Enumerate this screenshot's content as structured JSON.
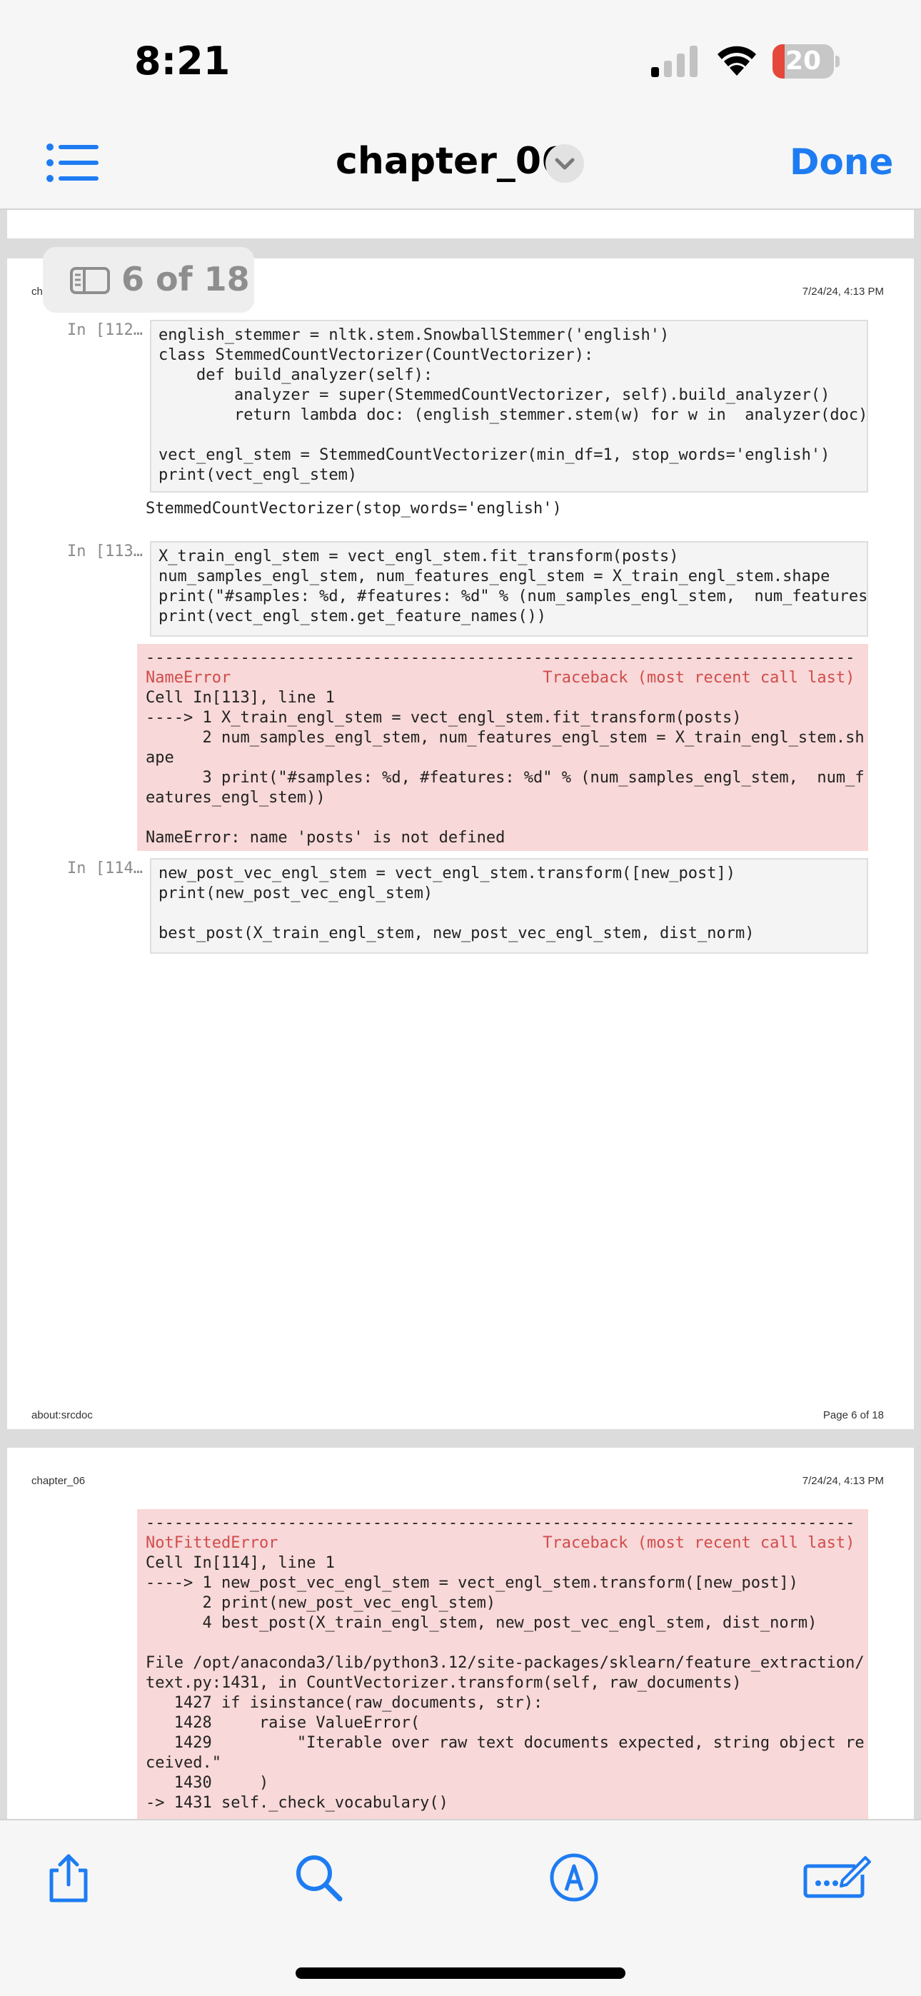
{
  "status_bar": {
    "time": "8:21",
    "battery_percent": 20,
    "battery_color": "#e5483b",
    "signal_bars_active": 1,
    "signal_bars_total": 4,
    "icons": [
      "cellular-signal-icon",
      "wifi-icon",
      "battery-icon"
    ]
  },
  "navbar": {
    "title": "chapter_06",
    "done_label": "Done",
    "accent_color": "#1e7cf2",
    "icons": [
      "list-icon",
      "chevron-down-icon"
    ]
  },
  "page_badge": {
    "text": "6 of 18",
    "icon": "sidebar-icon"
  },
  "current_page": {
    "header_title": "ch",
    "header_date": "7/24/24, 4:13 PM",
    "footer_source": "about:srcdoc",
    "footer_page": "Page 6 of 18",
    "cell1": {
      "prompt": "In [112…",
      "lines": [
        "english_stemmer = nltk.stem.SnowballStemmer('english')",
        "class StemmedCountVectorizer(CountVectorizer):",
        "    def build_analyzer(self):",
        "        analyzer = super(StemmedCountVectorizer, self).build_analyzer()",
        "        return lambda doc: (english_stemmer.stem(w) for w in  analyzer(doc))",
        "",
        "vect_engl_stem = StemmedCountVectorizer(min_df=1, stop_words='english')",
        "print(vect_engl_stem)"
      ],
      "output": "StemmedCountVectorizer(stop_words='english')"
    },
    "cell2": {
      "prompt": "In [113…",
      "lines": [
        "X_train_engl_stem = vect_engl_stem.fit_transform(posts)",
        "num_samples_engl_stem, num_features_engl_stem = X_train_engl_stem.shape",
        "print(\"#samples: %d, #features: %d\" % (num_samples_engl_stem,  num_features_",
        "print(vect_engl_stem.get_feature_names())"
      ],
      "error_lines": [
        "---------------------------------------------------------------------------",
        "NameError                                 Traceback (most recent call last)",
        "Cell In[113], line 1",
        "----> 1 X_train_engl_stem = vect_engl_stem.fit_transform(posts)",
        "      2 num_samples_engl_stem, num_features_engl_stem = X_train_engl_stem.sh",
        "ape",
        "      3 print(\"#samples: %d, #features: %d\" % (num_samples_engl_stem,  num_f",
        "eatures_engl_stem))",
        "",
        "NameError: name 'posts' is not defined"
      ]
    },
    "cell3": {
      "prompt": "In [114…",
      "lines": [
        "new_post_vec_engl_stem = vect_engl_stem.transform([new_post])",
        "print(new_post_vec_engl_stem)",
        "",
        "best_post(X_train_engl_stem, new_post_vec_engl_stem, dist_norm)"
      ]
    }
  },
  "next_page": {
    "header_title": "chapter_06",
    "header_date": "7/24/24, 4:13 PM",
    "error_lines": [
      "---------------------------------------------------------------------------",
      "NotFittedError                            Traceback (most recent call last)",
      "Cell In[114], line 1",
      "----> 1 new_post_vec_engl_stem = vect_engl_stem.transform([new_post])",
      "      2 print(new_post_vec_engl_stem)",
      "      4 best_post(X_train_engl_stem, new_post_vec_engl_stem, dist_norm)",
      "",
      "File /opt/anaconda3/lib/python3.12/site-packages/sklearn/feature_extraction/",
      "text.py:1431, in CountVectorizer.transform(self, raw_documents)",
      "   1427 if isinstance(raw_documents, str):",
      "   1428     raise ValueError(",
      "   1429         \"Iterable over raw text documents expected, string object re",
      "ceived.\"",
      "   1430     )",
      "-> 1431 self._check_vocabulary()"
    ]
  },
  "toolbar": {
    "icons": [
      "share-icon",
      "search-icon",
      "markup-icon",
      "edit-form-icon"
    ]
  }
}
